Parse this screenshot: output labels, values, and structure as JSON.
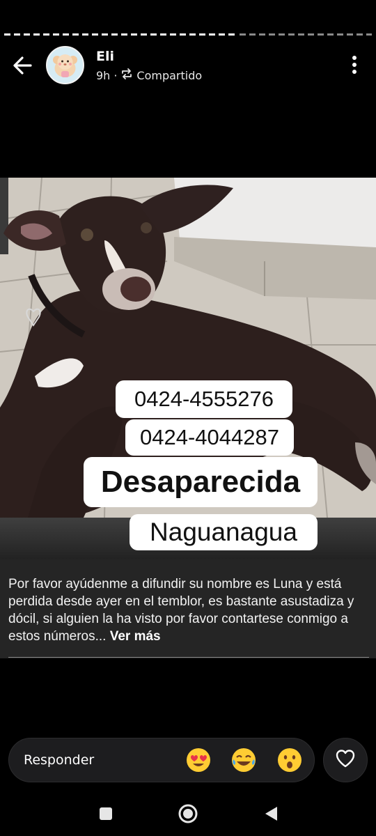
{
  "story": {
    "user_name": "Eli",
    "time_ago": "9h",
    "separator": "·",
    "shared_label": "Compartido"
  },
  "overlay": {
    "phone_1": "0424-4555276",
    "phone_2": "0424-4044287",
    "status": "Desaparecida",
    "location": "Naguanagua"
  },
  "caption": {
    "text": "Por favor ayúdenme a difundir su nombre es Luna y está perdida desde ayer en el temblor, es bastante asustadiza y dócil, si alguien la ha visto por favor contartese conmigo a estos números...",
    "more_label": "Ver más"
  },
  "reply": {
    "label": "Responder",
    "reactions": [
      "heart-eyes",
      "tears-of-joy",
      "surprised"
    ]
  },
  "icons": {
    "back": "back-arrow-icon",
    "menu": "more-vertical-icon",
    "shared": "repost-icon",
    "heart": "heart-icon",
    "nav": [
      "recents-square-icon",
      "home-circle-icon",
      "back-triangle-icon"
    ]
  }
}
